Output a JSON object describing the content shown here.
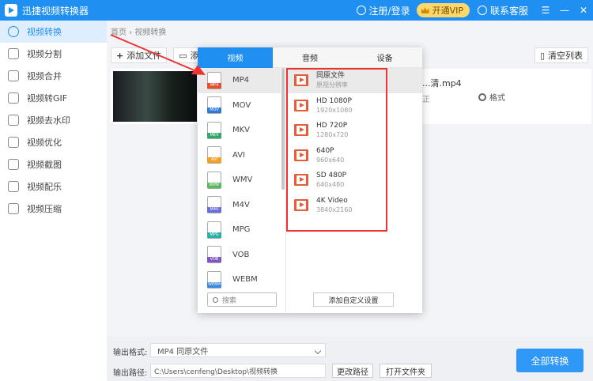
{
  "titlebar": {
    "title": "迅捷视频转换器",
    "login": "注册/登录",
    "vip": "开通VIP",
    "service": "联系客服",
    "menu": "☰",
    "minimize": "—",
    "close": "✕"
  },
  "sidebar": {
    "items": [
      {
        "label": "视频转换"
      },
      {
        "label": "视频分割"
      },
      {
        "label": "视频合并"
      },
      {
        "label": "视频转GIF"
      },
      {
        "label": "视频去水印"
      },
      {
        "label": "视频优化"
      },
      {
        "label": "视频截图"
      },
      {
        "label": "视频配乐"
      },
      {
        "label": "视频压缩"
      }
    ]
  },
  "breadcrumb": {
    "home": "首页",
    "sep": " › ",
    "current": "视频转换"
  },
  "toolbar": {
    "add_file": "添加文件",
    "add_folder": "添加",
    "clear": "清空列表"
  },
  "file": {
    "name": "...清.mp4",
    "label": "正",
    "format_btn": "格式"
  },
  "popup": {
    "tabs": [
      "视频",
      "音频",
      "设备"
    ],
    "formats": [
      {
        "name": "MP4",
        "badge": "MP4",
        "color": "#e4502e"
      },
      {
        "name": "MOV",
        "badge": "MOV",
        "color": "#2d7bd8"
      },
      {
        "name": "MKV",
        "badge": "MKV",
        "color": "#2ea86b"
      },
      {
        "name": "AVI",
        "badge": "AVI",
        "color": "#f0a024"
      },
      {
        "name": "WMV",
        "badge": "WMV",
        "color": "#5cb85c"
      },
      {
        "name": "M4V",
        "badge": "M4V",
        "color": "#6a6fd8"
      },
      {
        "name": "MPG",
        "badge": "MPG",
        "color": "#2bb0a6"
      },
      {
        "name": "VOB",
        "badge": "VOB",
        "color": "#7e57c2"
      },
      {
        "name": "WEBM",
        "badge": "WEBM",
        "color": "#3a86e0"
      }
    ],
    "presets": [
      {
        "name": "同原文件",
        "res": "原视分辨率"
      },
      {
        "name": "HD 1080P",
        "res": "1920x1080"
      },
      {
        "name": "HD 720P",
        "res": "1280x720"
      },
      {
        "name": "640P",
        "res": "960x640"
      },
      {
        "name": "SD 480P",
        "res": "640x480"
      },
      {
        "name": "4K Video",
        "res": "3840x2160"
      }
    ],
    "search_placeholder": "搜索",
    "add_custom": "添加自定义设置"
  },
  "bottom": {
    "format_label": "输出格式:",
    "format_value": "MP4  同原文件",
    "path_label": "输出路径:",
    "path_value": "C:\\Users\\cenfeng\\Desktop\\视频转换",
    "change_path": "更改路径",
    "open_folder": "打开文件夹",
    "convert_all": "全部转换"
  },
  "colors": {
    "accent": "#1f8ff2",
    "annotation": "#e33333"
  }
}
